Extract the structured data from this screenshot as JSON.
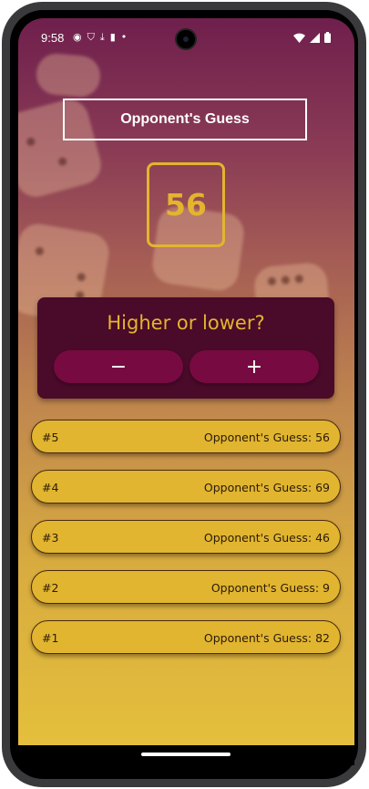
{
  "status_bar": {
    "time": "9:58",
    "left_icons": [
      "record-icon",
      "shield-icon",
      "download-icon",
      "sd-card-icon",
      "dot-icon"
    ],
    "right_icons": [
      "wifi-icon",
      "signal-icon",
      "battery-icon"
    ]
  },
  "header": {
    "title": "Opponent's Guess"
  },
  "current_guess": "56",
  "prompt_card": {
    "title": "Higher or lower?",
    "minus_label": "−",
    "plus_label": "+"
  },
  "log": [
    {
      "round": "#5",
      "text": "Opponent's Guess: 56"
    },
    {
      "round": "#4",
      "text": "Opponent's Guess: 69"
    },
    {
      "round": "#3",
      "text": "Opponent's Guess: 46"
    },
    {
      "round": "#2",
      "text": "Opponent's Guess: 9"
    },
    {
      "round": "#1",
      "text": "Opponent's Guess: 82"
    }
  ],
  "colors": {
    "accent": "#e3b52f",
    "card": "#4a0a29",
    "button": "#760a41",
    "gradient_top": "#6f1f4c",
    "gradient_bottom": "#e4bf3c"
  }
}
